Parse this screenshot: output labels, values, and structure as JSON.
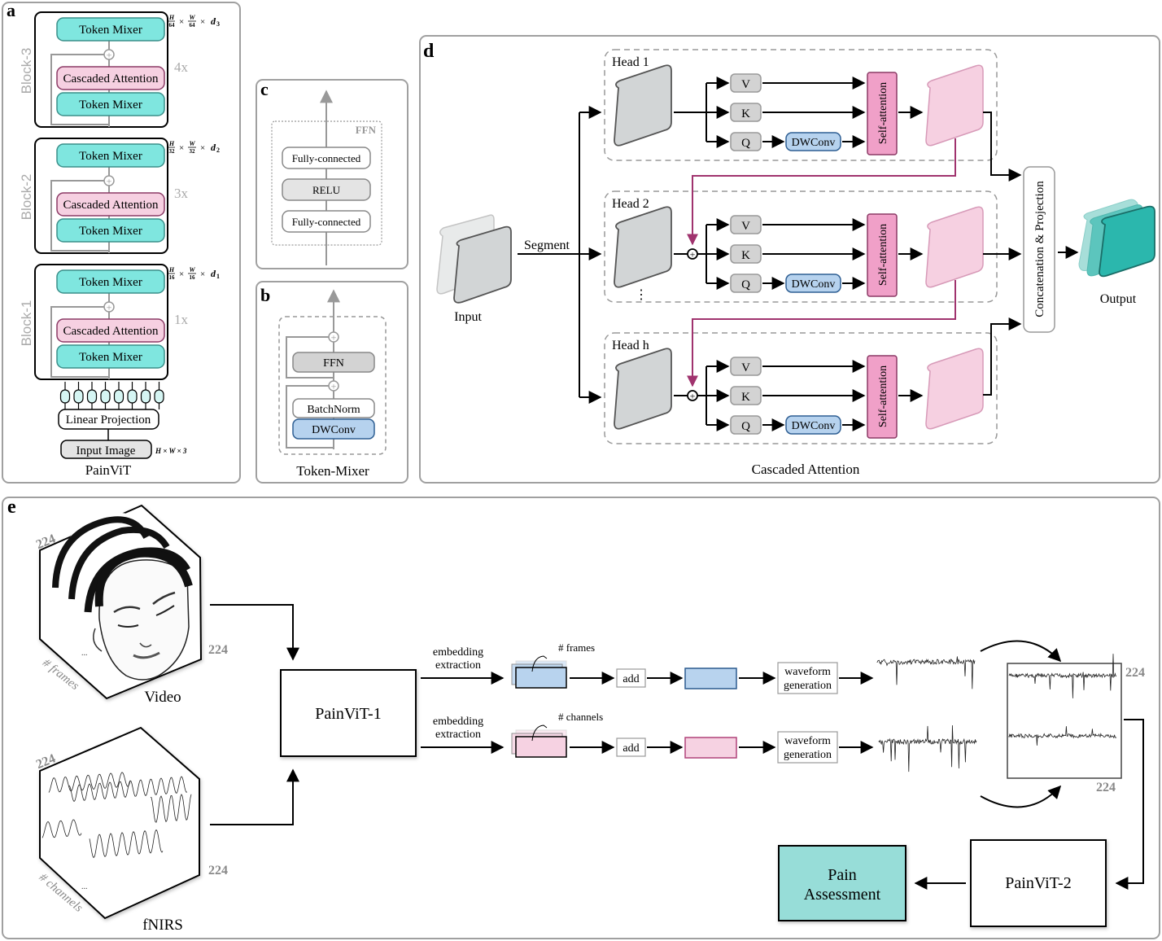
{
  "panels": {
    "a": {
      "letter": "a",
      "caption": "PainViT",
      "blocks": [
        {
          "name": "Block-3",
          "repeat": "4x",
          "top": "Token Mixer",
          "attn": "Cascaded Attention",
          "bottom": "Token Mixer",
          "dims": {
            "h": "H",
            "hd": "64",
            "w": "W",
            "wd": "64",
            "d": "d",
            "dsub": "3"
          }
        },
        {
          "name": "Block-2",
          "repeat": "3x",
          "top": "Token Mixer",
          "attn": "Cascaded Attention",
          "bottom": "Token Mixer",
          "dims": {
            "h": "H",
            "hd": "32",
            "w": "W",
            "wd": "32",
            "d": "d",
            "dsub": "2"
          }
        },
        {
          "name": "Block-1",
          "repeat": "1x",
          "top": "Token Mixer",
          "attn": "Cascaded Attention",
          "bottom": "Token Mixer",
          "dims": {
            "h": "H",
            "hd": "16",
            "w": "W",
            "wd": "16",
            "d": "d",
            "dsub": "1"
          }
        }
      ],
      "times": "×",
      "linear_projection": "Linear Projection",
      "input_image": "Input Image",
      "input_dims": "H × W × 3"
    },
    "b": {
      "letter": "b",
      "caption": "Token-Mixer",
      "ffn": "FFN",
      "batchnorm": "BatchNorm",
      "dwconv": "DWConv"
    },
    "c": {
      "letter": "c",
      "group_label": "FFN",
      "fc_top": "Fully-connected",
      "relu": "RELU",
      "fc_bottom": "Fully-connected"
    },
    "d": {
      "letter": "d",
      "caption": "Cascaded Attention",
      "input": "Input",
      "segment": "Segment",
      "output": "Output",
      "concat": "Concatenation & Projection",
      "heads": [
        {
          "label": "Head 1",
          "v": "V",
          "k": "K",
          "q": "Q",
          "dwconv": "DWConv",
          "attn": "Self-attention"
        },
        {
          "label": "Head 2",
          "v": "V",
          "k": "K",
          "q": "Q",
          "dwconv": "DWConv",
          "attn": "Self-attention"
        },
        {
          "label": "Head h",
          "v": "V",
          "k": "K",
          "q": "Q",
          "dwconv": "DWConv",
          "attn": "Self-attention"
        }
      ],
      "ellipsis": "⋮"
    },
    "e": {
      "letter": "e",
      "video": {
        "label": "Video",
        "dim_top": "224",
        "dim_side": "224",
        "depth": "# frames",
        "ellipsis": "..."
      },
      "fnirs": {
        "label": "fNIRS",
        "dim_top": "224",
        "dim_side": "224",
        "depth": "# channels",
        "ellipsis": "..."
      },
      "painvit1": "PainViT-1",
      "painvit2": "PainViT-2",
      "pain_assessment": [
        "Pain",
        "Assessment"
      ],
      "rows": [
        {
          "embed": [
            "embedding",
            "extraction"
          ],
          "stack_label": "# frames",
          "add": "add",
          "wave": [
            "waveform",
            "generation"
          ],
          "color": "#b8d3ee",
          "border": "#2c5b8f"
        },
        {
          "embed": [
            "embedding",
            "extraction"
          ],
          "stack_label": "# channels",
          "add": "add",
          "wave": [
            "waveform",
            "generation"
          ],
          "color": "#f6d2e2",
          "border": "#b0437a"
        }
      ],
      "combined_dims": {
        "right": "224",
        "bottom": "224"
      }
    }
  },
  "colors": {
    "teal": "#7fe6df",
    "teal_border": "#3a8f8a",
    "pink": "#f6d0e1",
    "pink_border": "#8c3a66",
    "attn_pink": "#f0a0c8",
    "dwconv_blue": "#b6d2ee",
    "dwconv_border": "#2f5f93",
    "magenta_line": "#a0336e",
    "output_teal": "#2bb7ad",
    "assessment_teal": "#97ddd8",
    "panel_border": "#9a9a9a"
  }
}
